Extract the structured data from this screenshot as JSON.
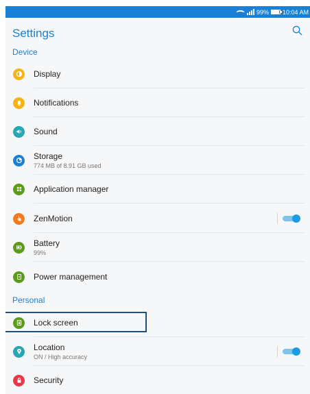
{
  "status_bar": {
    "battery": "99%",
    "time": "10:04 AM"
  },
  "app_bar": {
    "title": "Settings",
    "search_icon": "search-icon"
  },
  "sections": {
    "device": "Device",
    "personal": "Personal"
  },
  "items": [
    {
      "label": "Display",
      "sub": "",
      "icon": "display-icon",
      "color": "#f5b414"
    },
    {
      "label": "Notifications",
      "sub": "",
      "icon": "bell-icon",
      "color": "#f5b414"
    },
    {
      "label": "Sound",
      "sub": "",
      "icon": "speaker-icon",
      "color": "#27a6b4"
    },
    {
      "label": "Storage",
      "sub": "774 MB of 8.91 GB used",
      "icon": "storage-icon",
      "color": "#1a80d3"
    },
    {
      "label": "Application manager",
      "sub": "",
      "icon": "apps-icon",
      "color": "#5a9c1a"
    },
    {
      "label": "ZenMotion",
      "sub": "",
      "icon": "hand-icon",
      "color": "#f47a20",
      "toggle": true
    },
    {
      "label": "Battery",
      "sub": "99%",
      "icon": "battery-icon",
      "color": "#5a9c1a"
    },
    {
      "label": "Power management",
      "sub": "",
      "icon": "power-icon",
      "color": "#5a9c1a"
    },
    {
      "label": "Lock screen",
      "sub": "",
      "icon": "lock-screen-icon",
      "color": "#5a9c1a"
    },
    {
      "label": "Location",
      "sub": "ON / High accuracy",
      "icon": "location-icon",
      "color": "#27a6b4",
      "toggle": true
    },
    {
      "label": "Security",
      "sub": "",
      "icon": "lock-icon",
      "color": "#e8394a"
    }
  ],
  "colors": {
    "accent": "#1a80d3",
    "status_bar": "#1a80d3",
    "highlight_box": "#1b4f8a"
  }
}
